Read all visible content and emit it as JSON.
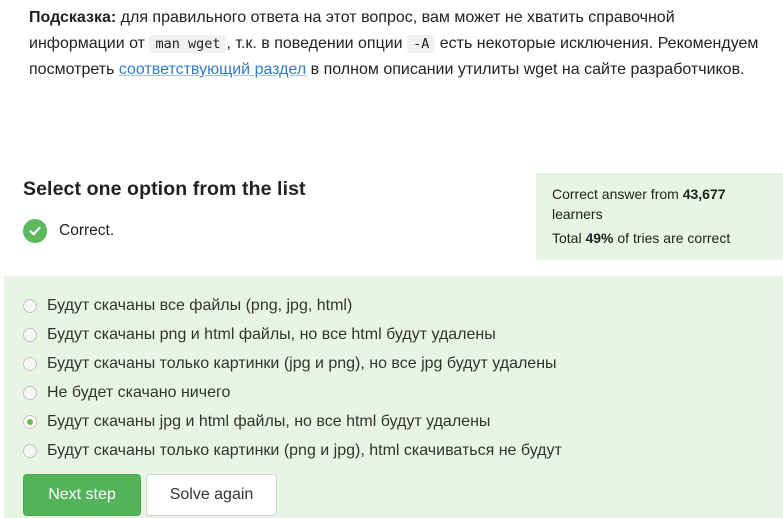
{
  "hint": {
    "label": "Подсказка:",
    "text1": " для правильного ответа на этот вопрос, вам может не хватить справочной информации от ",
    "code1": "man wget",
    "text2": ", т.к. в поведении опции ",
    "code2": "-A",
    "text3": " есть некоторые исключения. Рекомендуем посмотреть ",
    "link": "соответствующий раздел",
    "text4": " в полном описании утилиты wget на сайте разработчиков."
  },
  "quiz": {
    "heading": "Select one option from the list",
    "status": "Correct.",
    "status_icon": "check-circle-icon"
  },
  "stats": {
    "answer_prefix": "Correct answer from ",
    "learners_count": "43,677",
    "learners_suffix": " learners",
    "total_prefix": "Total ",
    "percent": "49%",
    "total_suffix": " of tries are correct"
  },
  "options": [
    {
      "label": "Будут скачаны все файлы (png, jpg, html)",
      "selected": false
    },
    {
      "label": "Будут скачаны png и html файлы, но все html будут удалены",
      "selected": false
    },
    {
      "label": "Будут скачаны только картинки (jpg и png), но все jpg будут удалены",
      "selected": false
    },
    {
      "label": "Не будет скачано ничего",
      "selected": false
    },
    {
      "label": "Будут скачаны jpg и html файлы, но все html будут удалены",
      "selected": true
    },
    {
      "label": "Будут скачаны только картинки (png и jpg), html скачиваться не будут",
      "selected": false
    }
  ],
  "buttons": {
    "next": "Next step",
    "solve_again": "Solve again"
  },
  "colors": {
    "accent_green": "#54b45a",
    "panel_bg": "#e9f5e4",
    "link": "#2e7bcf"
  }
}
